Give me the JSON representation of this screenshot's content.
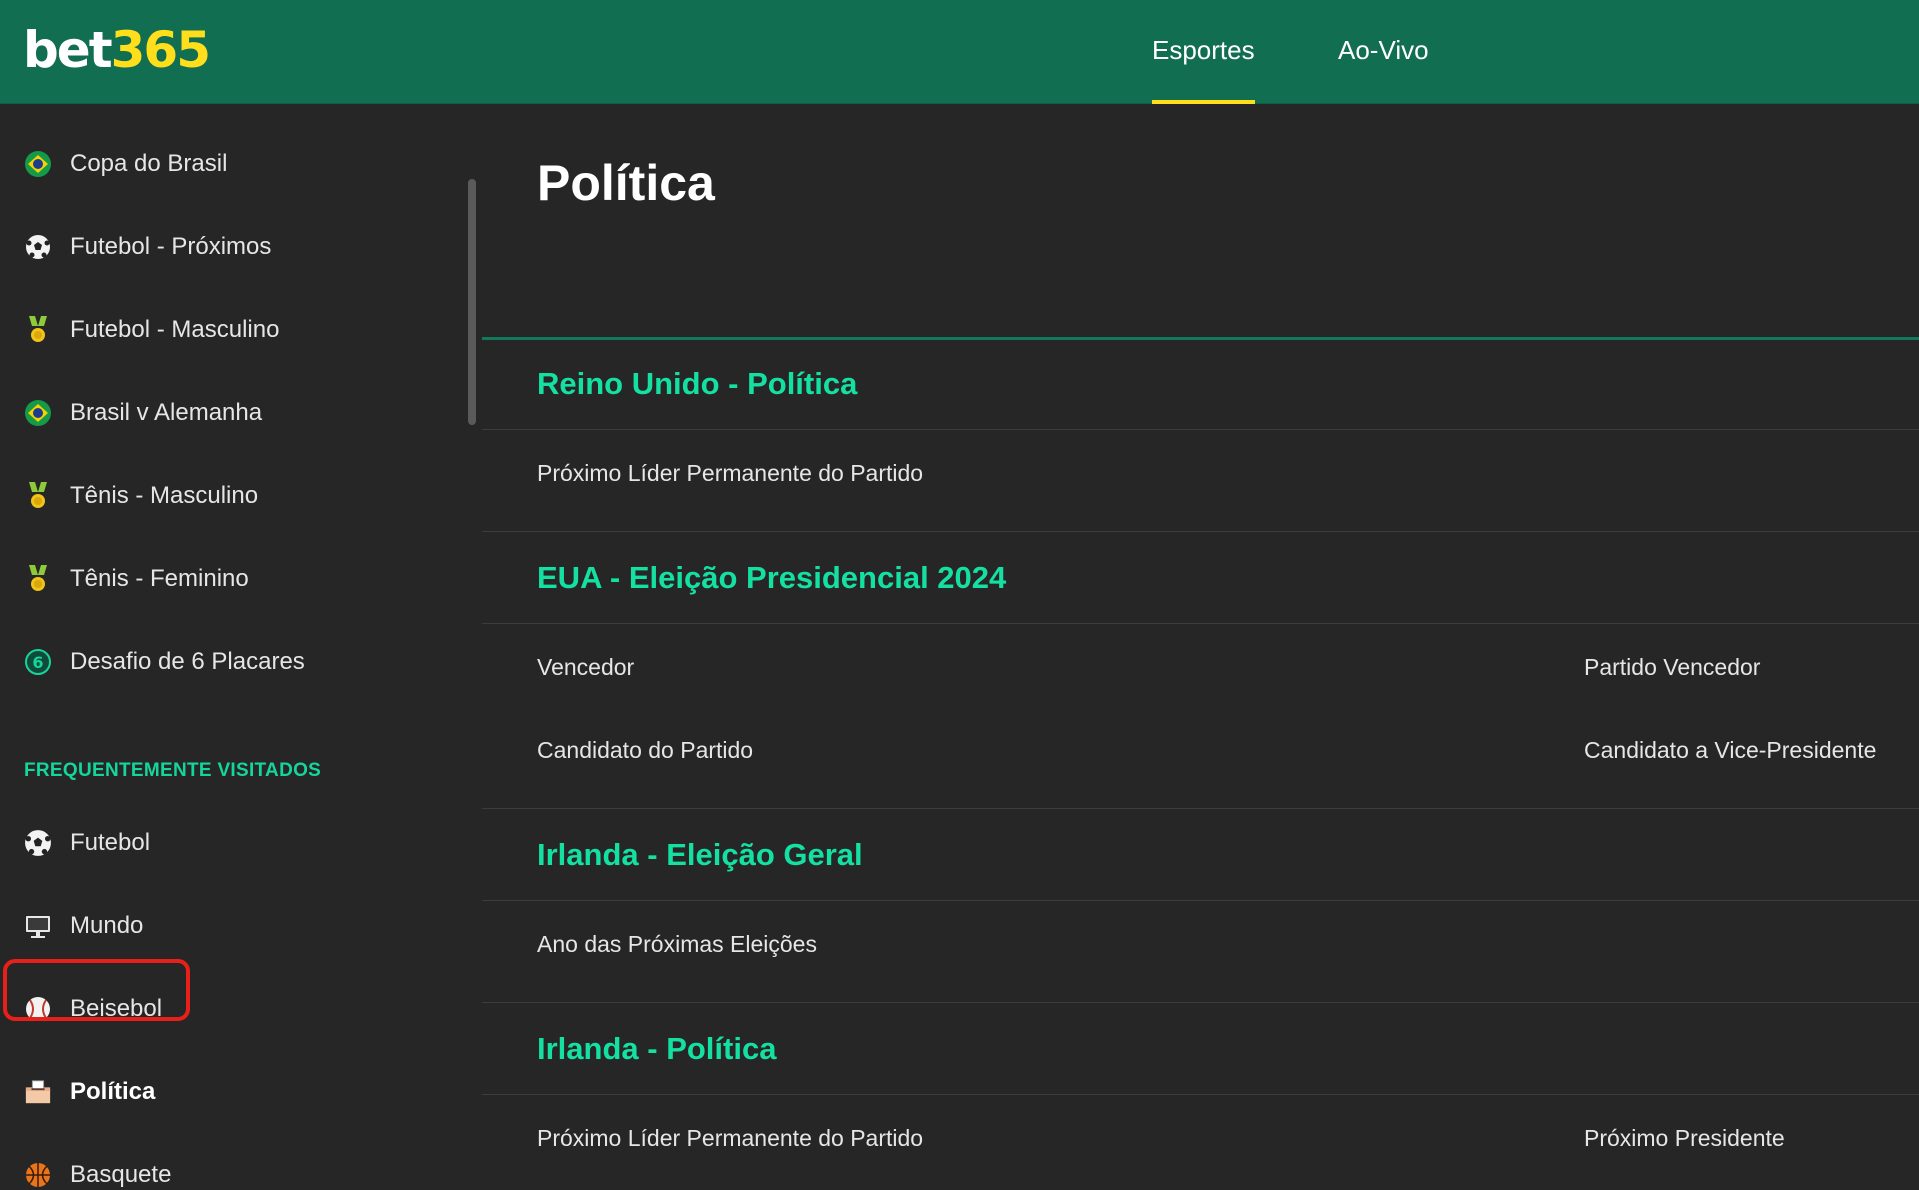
{
  "header": {
    "logo_bet": "bet",
    "logo_num": "365",
    "tabs": [
      {
        "label": "Esportes",
        "active": true
      },
      {
        "label": "Ao-Vivo",
        "active": false
      }
    ],
    "accent": "#ffdf1b",
    "brand_color": "#126e51"
  },
  "sidebar": {
    "items": [
      {
        "label": "Copa do Brasil",
        "icon": "brazil-flag-icon"
      },
      {
        "label": "Futebol - Próximos",
        "icon": "soccer-ball-icon"
      },
      {
        "label": "Futebol - Masculino",
        "icon": "medal-icon"
      },
      {
        "label": "Brasil v Alemanha",
        "icon": "brazil-flag-icon"
      },
      {
        "label": "Tênis - Masculino",
        "icon": "medal-icon"
      },
      {
        "label": "Tênis - Feminino",
        "icon": "medal-icon"
      },
      {
        "label": "Desafio de 6 Placares",
        "icon": "six-score-icon"
      }
    ],
    "frequent_header": "FREQUENTEMENTE VISITADOS",
    "frequent": [
      {
        "label": "Futebol",
        "icon": "soccer-ball-icon"
      },
      {
        "label": "Mundo",
        "icon": "monitor-icon"
      },
      {
        "label": "Beisebol",
        "icon": "baseball-icon"
      },
      {
        "label": "Política",
        "icon": "ballot-box-icon",
        "selected": true
      },
      {
        "label": "Basquete",
        "icon": "basketball-icon"
      }
    ],
    "highlight_color": "#e8201a"
  },
  "main": {
    "title": "Política",
    "groups": [
      {
        "title": "Reino Unido - Política",
        "markets": [
          [
            "Próximo Líder Permanente do Partido",
            ""
          ]
        ]
      },
      {
        "title": "EUA - Eleição Presidencial 2024",
        "markets": [
          [
            "Vencedor",
            "Partido Vencedor"
          ],
          [
            "Candidato do Partido",
            "Candidato a Vice-Presidente"
          ]
        ]
      },
      {
        "title": "Irlanda - Eleição Geral",
        "markets": [
          [
            "Ano das Próximas Eleições",
            ""
          ]
        ]
      },
      {
        "title": "Irlanda - Política",
        "markets": [
          [
            "Próximo Líder Permanente do Partido",
            "Próximo Presidente"
          ]
        ]
      }
    ],
    "group_color": "#14e0a2"
  }
}
